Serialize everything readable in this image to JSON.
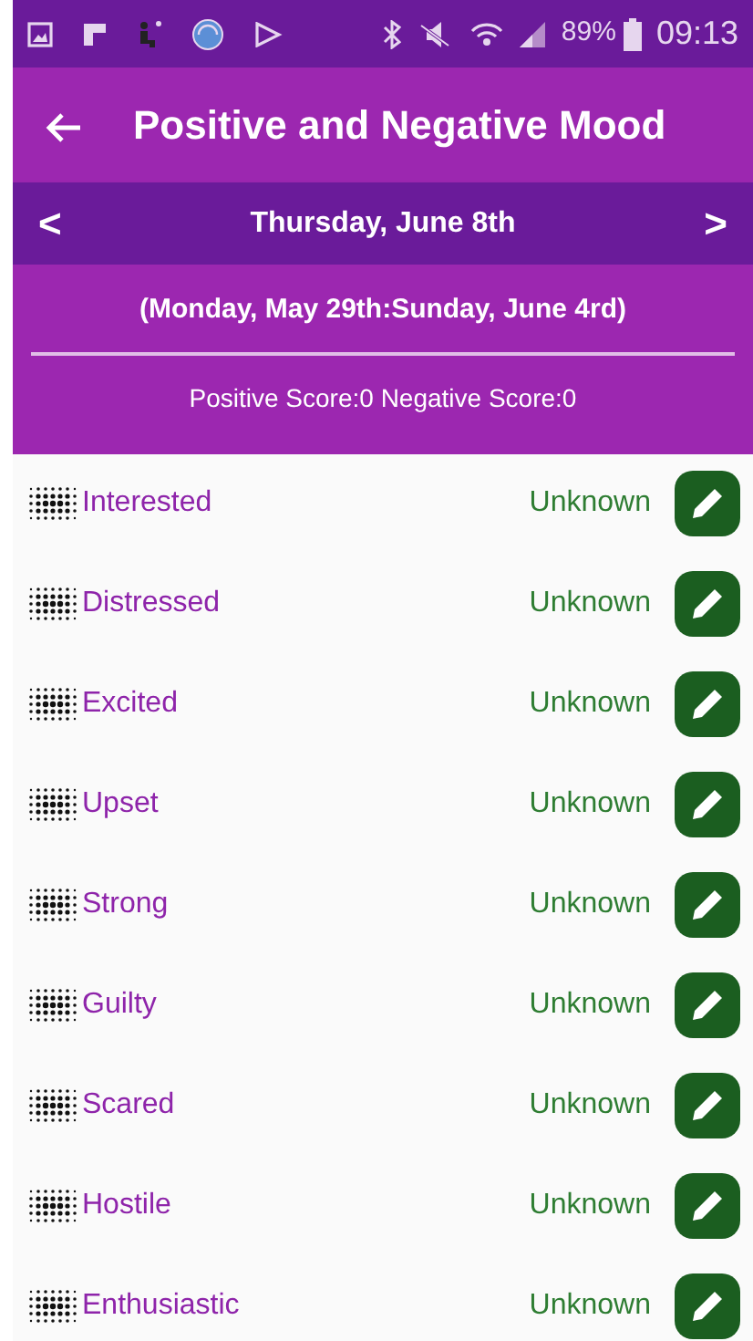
{
  "status_bar": {
    "battery": "89%",
    "time": "09:13"
  },
  "toolbar": {
    "title": "Positive and Negative Mood"
  },
  "date_bar": {
    "prev": "<",
    "date": "Thursday, June 8th",
    "next": ">"
  },
  "summary": {
    "range": "(Monday, May 29th:Sunday, June 4rd)",
    "scores": "Positive Score:0 Negative Score:0"
  },
  "moods": [
    {
      "label": "Interested",
      "value": "Unknown"
    },
    {
      "label": "Distressed",
      "value": "Unknown"
    },
    {
      "label": "Excited",
      "value": "Unknown"
    },
    {
      "label": "Upset",
      "value": "Unknown"
    },
    {
      "label": "Strong",
      "value": "Unknown"
    },
    {
      "label": "Guilty",
      "value": "Unknown"
    },
    {
      "label": "Scared",
      "value": "Unknown"
    },
    {
      "label": "Hostile",
      "value": "Unknown"
    },
    {
      "label": "Enthusiastic",
      "value": "Unknown"
    }
  ]
}
